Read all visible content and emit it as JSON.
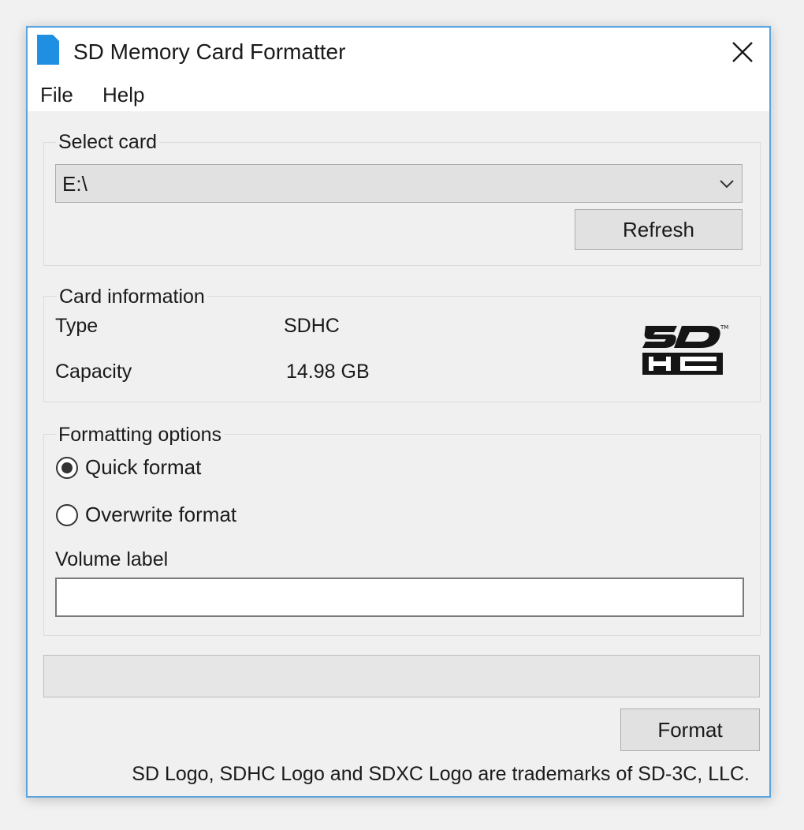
{
  "window": {
    "title": "SD Memory Card Formatter",
    "icon": "sd-card-icon",
    "close_icon": "close-icon",
    "accent_color": "#1e8fe1"
  },
  "menu": {
    "items": [
      {
        "label": "File"
      },
      {
        "label": "Help"
      }
    ]
  },
  "select_card": {
    "title": "Select card",
    "selected": "E:\\",
    "refresh_label": "Refresh"
  },
  "card_info": {
    "title": "Card information",
    "type_label": "Type",
    "type_value": "SDHC",
    "capacity_label": "Capacity",
    "capacity_value": "14.98 GB",
    "logo": "sdhc-logo"
  },
  "formatting": {
    "title": "Formatting options",
    "options": [
      {
        "label": "Quick format",
        "selected": true
      },
      {
        "label": "Overwrite format",
        "selected": false
      }
    ],
    "volume_label_title": "Volume label",
    "volume_label_value": ""
  },
  "progress": {
    "percent": 0
  },
  "actions": {
    "format_label": "Format"
  },
  "footer": {
    "trademark": "SD Logo, SDHC Logo and SDXC Logo are trademarks of SD-3C, LLC."
  }
}
